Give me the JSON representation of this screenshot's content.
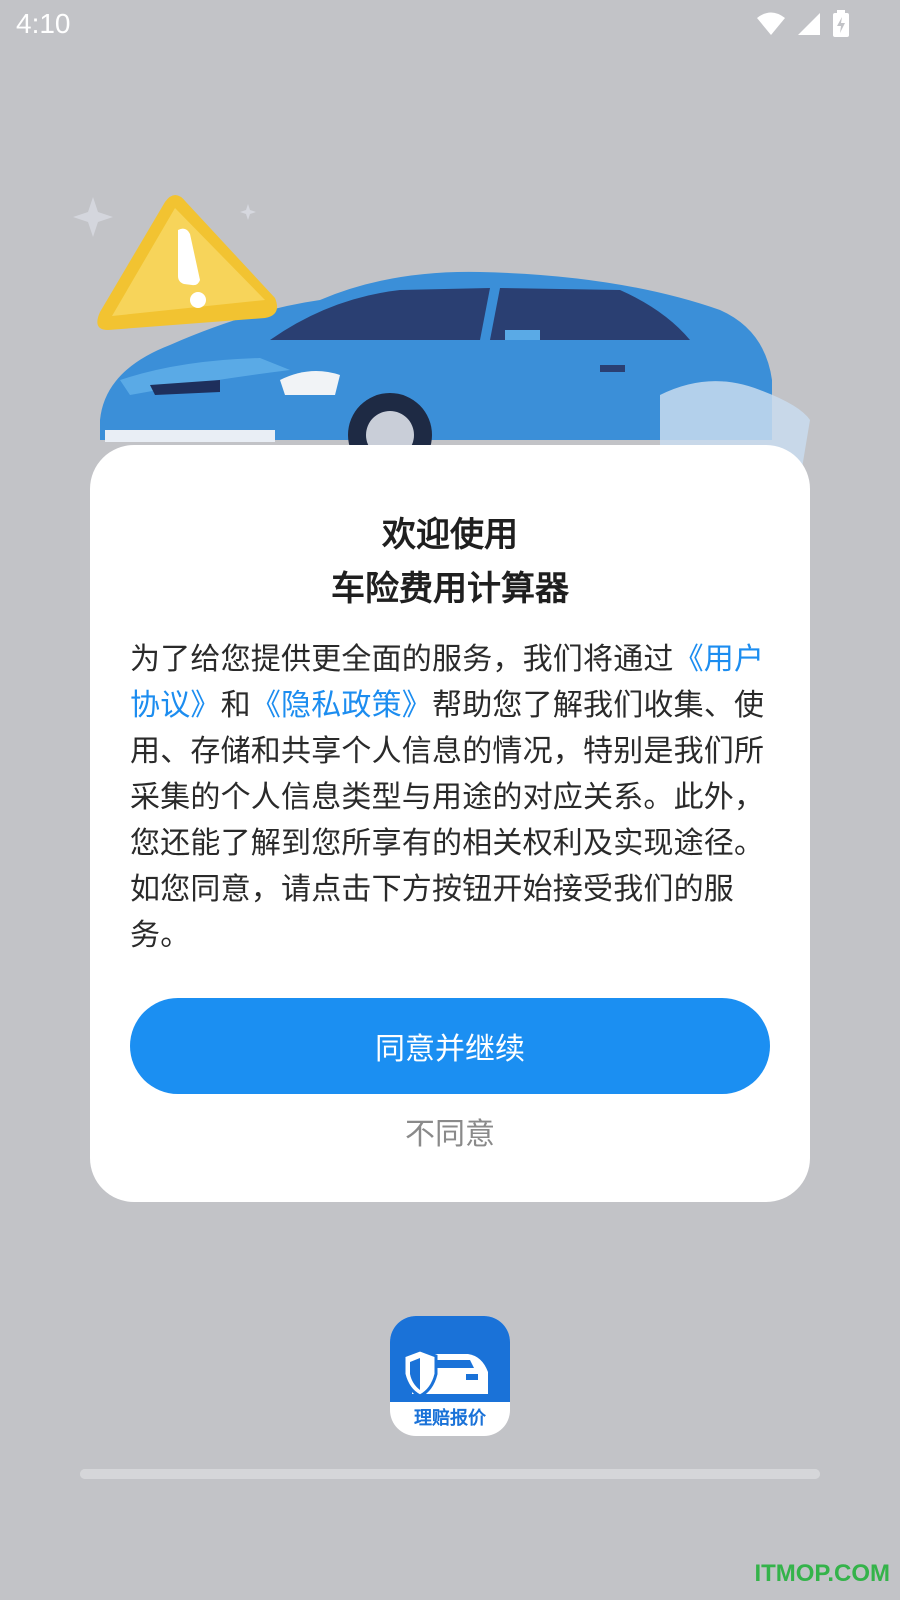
{
  "status_bar": {
    "time": "4:10",
    "icons": [
      "wifi-icon",
      "signal-icon",
      "battery-charging-icon"
    ]
  },
  "dialog": {
    "title_line1": "欢迎使用",
    "title_line2": "车险费用计算器",
    "body": {
      "part1": "为了给您提供更全面的服务，我们将通过",
      "link_user_agreement": "《用户协议》",
      "part2": "和",
      "link_privacy_policy": "《隐私政策》",
      "part3": "帮助您了解我们收集、使用、存储和共享个人信息的情况，特别是我们所采集的个人信息类型与用途的对应关系。此外，您还能了解到您所享有的相关权利及实现途径。如您同意，请点击下方按钮开始接受我们的服务。"
    },
    "agree_label": "同意并继续",
    "disagree_label": "不同意"
  },
  "app_icon": {
    "caption": "理赔报价"
  },
  "watermark": "ITMOP.COM",
  "colors": {
    "accent": "#1b8ff2",
    "link": "#1c8df0",
    "overlay": "#c2c3c7",
    "watermark": "#34b34a"
  }
}
